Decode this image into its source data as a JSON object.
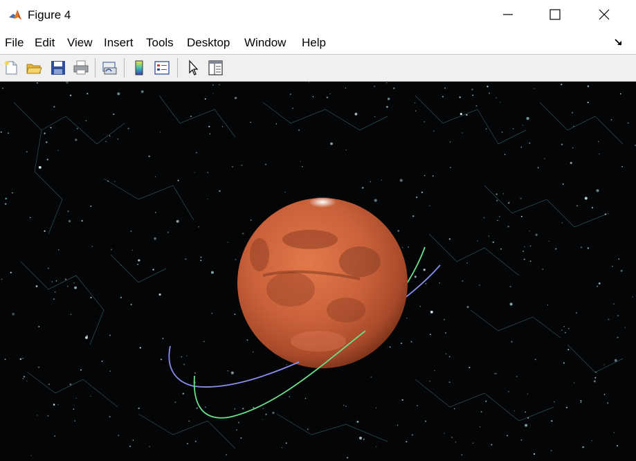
{
  "window": {
    "title": "Figure 4"
  },
  "menu": [
    "File",
    "Edit",
    "View",
    "Insert",
    "Tools",
    "Desktop",
    "Window",
    "Help"
  ],
  "toolbar": [
    "new-figure",
    "open-file",
    "save-figure",
    "print-figure",
    "link-plot",
    "insert-colorbar",
    "insert-legend",
    "edit-plot",
    "property-inspector"
  ],
  "colors": {
    "background": "#040506",
    "planet": "#c8603a",
    "orbit_blue": "#8a8ff0",
    "orbit_green": "#6ae08a",
    "toolbar_bg": "#f0f0f0"
  }
}
